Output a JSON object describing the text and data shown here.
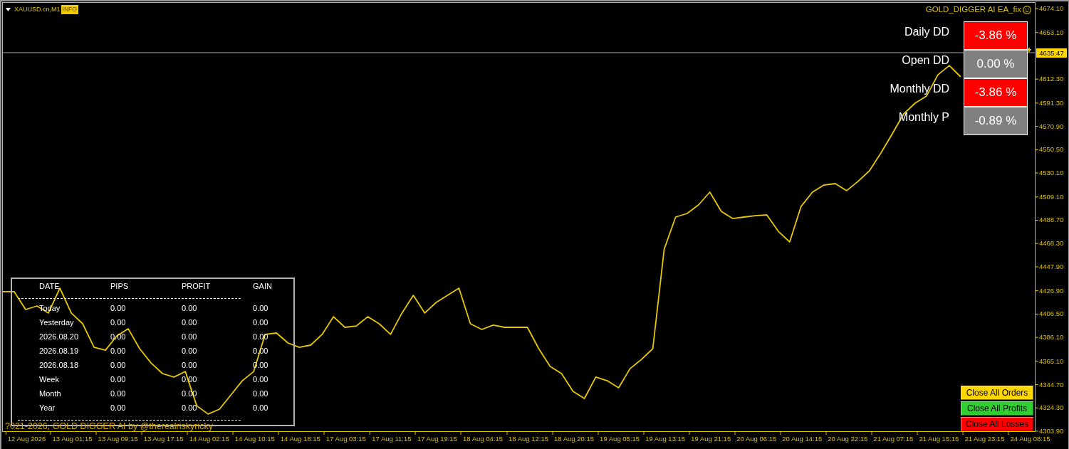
{
  "chart_header": {
    "symbol": "XAUUSD.cn,M1",
    "badge": "INFO",
    "expert": "GOLD_DIGGER AI EA_fix"
  },
  "dd_panel": [
    {
      "label": "Daily DD",
      "value": "-3.86 %",
      "color": "#ff0000"
    },
    {
      "label": "Open DD",
      "value": "0.00 %",
      "color": "#808080"
    },
    {
      "label": "Monthly DD",
      "value": "-3.86 %",
      "color": "#ff0000"
    },
    {
      "label": "Monthly P",
      "value": "-0.89 %",
      "color": "#808080"
    }
  ],
  "stats_table": {
    "columns": [
      "DATE",
      "PIPS",
      "PROFIT",
      "GAIN"
    ],
    "rows": [
      [
        "Today",
        "0.00",
        "0.00",
        "0.00"
      ],
      [
        "Yesterday",
        "0.00",
        "0.00",
        "0.00"
      ],
      [
        "2026.08.20",
        "0.00",
        "0.00",
        "0.00"
      ],
      [
        "2026.08.19",
        "0.00",
        "0.00",
        "0.00"
      ],
      [
        "2026.08.18",
        "0.00",
        "0.00",
        "0.00"
      ],
      [
        "Week",
        "0.00",
        "0.00",
        "0.00"
      ],
      [
        "Month",
        "0.00",
        "0.00",
        "0.00"
      ],
      [
        "Year",
        "0.00",
        "0.00",
        "0.00"
      ]
    ]
  },
  "copyright": "?021-2026, GOLD DIGGER AI by @therealriskyricky",
  "buttons": [
    {
      "label": "Close All Orders",
      "color": "#ffd700"
    },
    {
      "label": "Close All Profits",
      "color": "#32cd32"
    },
    {
      "label": "Close All Losses",
      "color": "#ff0000"
    }
  ],
  "chart": {
    "chart_data": {
      "type": "line",
      "categories": [
        null,
        null,
        "12 Aug 2026",
        null,
        null,
        null,
        "13 Aug 01:15",
        null,
        null,
        null,
        "13 Aug 09:15",
        null,
        null,
        null,
        "13 Aug 17:15",
        null,
        null,
        null,
        "14 Aug 02:15",
        null,
        null,
        null,
        "14 Aug 10:15",
        null,
        null,
        null,
        "14 Aug 18:15",
        null,
        null,
        null,
        "17 Aug 03:15",
        null,
        null,
        null,
        "17 Aug 11:15",
        null,
        null,
        null,
        "17 Aug 19:15",
        null,
        null,
        null,
        "18 Aug 04:15",
        null,
        null,
        null,
        "18 Aug 12:15",
        null,
        null,
        null,
        "18 Aug 20:15",
        null,
        null,
        null,
        "19 Aug 05:15",
        null,
        null,
        null,
        "19 Aug 13:15",
        null,
        null,
        null,
        "19 Aug 21:15",
        null,
        null,
        null,
        "20 Aug 06:15",
        null,
        null,
        null,
        "20 Aug 14:15",
        null,
        null,
        null,
        "20 Aug 22:15",
        null,
        null,
        null,
        "21 Aug 07:15",
        null,
        null,
        null,
        "21 Aug 15:15",
        null,
        null,
        null,
        "21 Aug 23:15",
        null,
        null,
        null,
        "24 Aug 08:15"
      ],
      "series": [
        {
          "color": "#e6c800",
          "values": [
            4426.1,
            4426.1,
            4410.5,
            4413.6,
            4407.4,
            4429.2,
            4407.4,
            4398.0,
            4377.4,
            4374.9,
            4387.4,
            4393.6,
            4376.2,
            4363.7,
            4354.4,
            4351.3,
            4356.2,
            4326.3,
            4318.9,
            4323.2,
            4335.7,
            4348.1,
            4356.2,
            4388.7,
            4389.9,
            4381.2,
            4377.4,
            4379.3,
            4388.7,
            4404.2,
            4394.9,
            4396.1,
            4404.2,
            4398.0,
            4388.7,
            4407.4,
            4422.9,
            4407.4,
            4416.7,
            4422.9,
            4429.2,
            4398.0,
            4393.0,
            4396.8,
            4394.9,
            4394.9,
            4394.9,
            4376.2,
            4360.6,
            4354.4,
            4338.8,
            4332.6,
            4351.3,
            4348.1,
            4341.9,
            4358.7,
            4366.8,
            4376.2,
            4463.4,
            4491.5,
            4494.6,
            4502.1,
            4513.3,
            4496.5,
            4490.2,
            4491.5,
            4492.7,
            4493.4,
            4479.0,
            4469.7,
            4500.8,
            4513.3,
            4519.5,
            4520.8,
            4514.6,
            4522.7,
            4532.0,
            4547.6,
            4564.4,
            4581.9,
            4591.2,
            4597.4,
            4616.1,
            4624.2,
            4614.3,
            null,
            null,
            null,
            null,
            null,
            4638.0
          ]
        }
      ],
      "ylim": [
        4303.9,
        4679.1
      ],
      "yticks": [
        {
          "value": 4674.1,
          "label": "4674.10"
        },
        {
          "value": 4653.1,
          "label": "4653.10"
        },
        {
          "value": 4612.3,
          "label": "4612.30"
        },
        {
          "value": 4591.3,
          "label": "4591.30"
        },
        {
          "value": 4570.9,
          "label": "4570.90"
        },
        {
          "value": 4550.5,
          "label": "4550.50"
        },
        {
          "value": 4530.1,
          "label": "4530.10"
        },
        {
          "value": 4509.1,
          "label": "4509.10"
        },
        {
          "value": 4488.7,
          "label": "4488.70"
        },
        {
          "value": 4468.3,
          "label": "4468.30"
        },
        {
          "value": 4447.9,
          "label": "4447.90"
        },
        {
          "value": 4426.9,
          "label": "4426.90"
        },
        {
          "value": 4406.5,
          "label": "4406.50"
        },
        {
          "value": 4386.1,
          "label": "4386.10"
        },
        {
          "value": 4365.1,
          "label": "4365.10"
        },
        {
          "value": 4344.7,
          "label": "4344.70"
        },
        {
          "value": 4324.3,
          "label": "4324.30"
        },
        {
          "value": 4303.9,
          "label": "4303.90"
        }
      ],
      "ref_lines": [
        {
          "axis": "y",
          "value": 4635.47,
          "label": "4635.47"
        }
      ]
    }
  }
}
